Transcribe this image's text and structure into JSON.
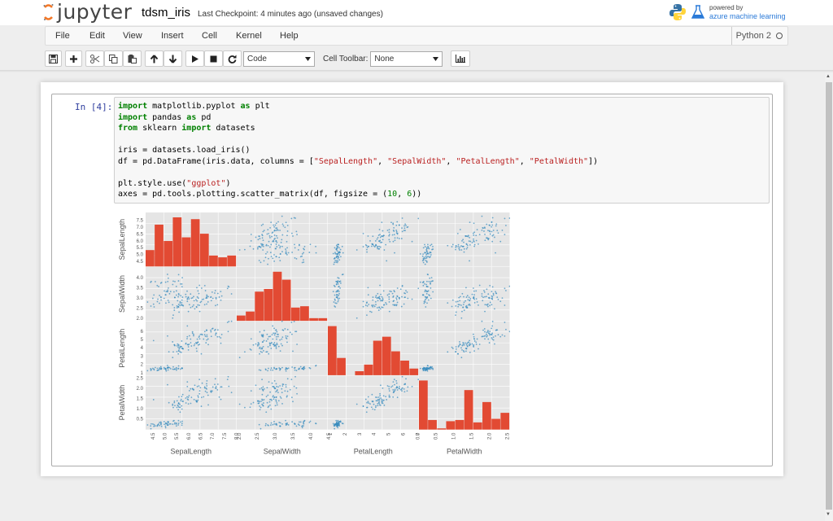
{
  "header": {
    "logo_text": "jupyter",
    "notebook_name": "tdsm_iris",
    "checkpoint": "Last Checkpoint: 4 minutes ago (unsaved changes)",
    "powered_by": "powered by",
    "azure": "azure machine learning"
  },
  "menu": {
    "items": [
      "File",
      "Edit",
      "View",
      "Insert",
      "Cell",
      "Kernel",
      "Help"
    ],
    "kernel_name": "Python 2"
  },
  "toolbar": {
    "cell_type": "Code",
    "cell_toolbar_label": "Cell Toolbar:",
    "cell_toolbar_value": "None",
    "icons": [
      "save-icon",
      "plus-icon",
      "cut-icon",
      "copy-icon",
      "paste-icon",
      "arrow-up-icon",
      "arrow-down-icon",
      "play-icon",
      "stop-icon",
      "restart-icon",
      "bar-chart-icon"
    ]
  },
  "cell": {
    "prompt": "In [4]:",
    "code": [
      [
        {
          "t": "import",
          "c": "kw"
        },
        {
          "t": " matplotlib.pyplot "
        },
        {
          "t": "as",
          "c": "kw"
        },
        {
          "t": " plt"
        }
      ],
      [
        {
          "t": "import",
          "c": "kw"
        },
        {
          "t": " pandas "
        },
        {
          "t": "as",
          "c": "kw"
        },
        {
          "t": " pd"
        }
      ],
      [
        {
          "t": "from",
          "c": "kw"
        },
        {
          "t": " sklearn "
        },
        {
          "t": "import",
          "c": "kw"
        },
        {
          "t": " datasets"
        }
      ],
      [],
      [
        {
          "t": "iris = datasets.load_iris()"
        }
      ],
      [
        {
          "t": "df = pd.DataFrame(iris.data, columns = ["
        },
        {
          "t": "\"SepalLength\"",
          "c": "str"
        },
        {
          "t": ", "
        },
        {
          "t": "\"SepalWidth\"",
          "c": "str"
        },
        {
          "t": ", "
        },
        {
          "t": "\"PetalLength\"",
          "c": "str"
        },
        {
          "t": ", "
        },
        {
          "t": "\"PetalWidth\"",
          "c": "str"
        },
        {
          "t": "])"
        }
      ],
      [],
      [
        {
          "t": "plt.style.use("
        },
        {
          "t": "\"ggplot\"",
          "c": "str"
        },
        {
          "t": ")"
        }
      ],
      [
        {
          "t": "axes = pd.tools.plotting.scatter_matrix(df, figsize = ("
        },
        {
          "t": "10",
          "c": "num"
        },
        {
          "t": ", "
        },
        {
          "t": "6",
          "c": "num"
        },
        {
          "t": "))"
        }
      ]
    ]
  },
  "colors": {
    "hist_bar": "#e24a33",
    "scatter_point": "#348abd",
    "panel_bg": "#e5e5e5",
    "keyword": "#008000",
    "string": "#ba2121"
  },
  "chart_data": {
    "type": "scatter",
    "variables": [
      "SepalLength",
      "SepalWidth",
      "PetalLength",
      "PetalWidth"
    ],
    "ranges": [
      [
        4.3,
        7.9
      ],
      [
        2.0,
        4.4
      ],
      [
        1.0,
        6.9
      ],
      [
        0.1,
        2.5
      ]
    ],
    "y_tick_labels": [
      [
        "4.5",
        "5.0",
        "5.5",
        "6.0",
        "6.5",
        "7.0",
        "7.5"
      ],
      [
        "2.0",
        "2.5",
        "3.0",
        "3.5",
        "4.0"
      ],
      [
        "1",
        "2",
        "3",
        "4",
        "5",
        "6"
      ],
      [
        "0.5",
        "1.0",
        "1.5",
        "2.0",
        "2.5"
      ]
    ],
    "x_tick_labels": [
      [
        "4.5",
        "5.0",
        "5.5",
        "6.0",
        "6.5",
        "7.0",
        "7.5",
        "8.0"
      ],
      [
        "2.0",
        "2.5",
        "3.0",
        "3.5",
        "4.0",
        "4.5"
      ],
      [
        "1",
        "2",
        "3",
        "4",
        "5",
        "6",
        "7"
      ],
      [
        "0.0",
        "0.5",
        "1.0",
        "1.5",
        "2.0",
        "2.5"
      ]
    ],
    "histograms": [
      {
        "variable": "SepalLength",
        "counts": [
          9,
          23,
          14,
          27,
          16,
          26,
          18,
          6,
          5,
          6
        ]
      },
      {
        "variable": "SepalWidth",
        "counts": [
          4,
          7,
          22,
          24,
          37,
          31,
          10,
          11,
          2,
          2
        ]
      },
      {
        "variable": "PetalLength",
        "counts": [
          37,
          13,
          0,
          3,
          8,
          26,
          29,
          18,
          11,
          5
        ]
      },
      {
        "variable": "PetalWidth",
        "counts": [
          41,
          8,
          1,
          7,
          8,
          33,
          6,
          23,
          9,
          14
        ]
      }
    ],
    "grid": true,
    "style": "ggplot"
  }
}
